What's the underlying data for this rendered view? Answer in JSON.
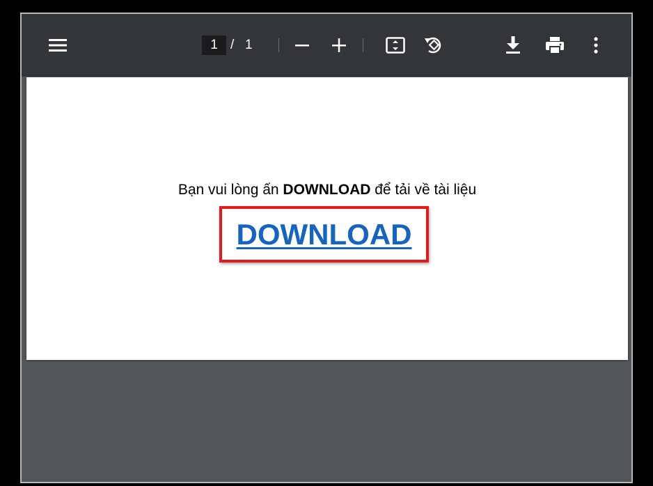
{
  "toolbar": {
    "menu_icon": "hamburger-menu-icon",
    "page_current": "1",
    "page_separator": "/",
    "page_total": "1",
    "zoom_out_icon": "minus-icon",
    "zoom_in_icon": "plus-icon",
    "fit_icon": "fit-to-page-icon",
    "rotate_icon": "rotate-icon",
    "download_icon": "download-icon",
    "print_icon": "print-icon",
    "more_icon": "more-vertical-icon"
  },
  "document": {
    "intro_prefix": "Bạn vui lòng ấn ",
    "intro_bold": "DOWNLOAD",
    "intro_suffix": " để tải về tài liệu",
    "download_link": "DOWNLOAD"
  },
  "colors": {
    "toolbar_bg": "#323639",
    "viewer_bg": "#525659",
    "link": "#1565c0",
    "highlight_border": "#e31b1b"
  }
}
